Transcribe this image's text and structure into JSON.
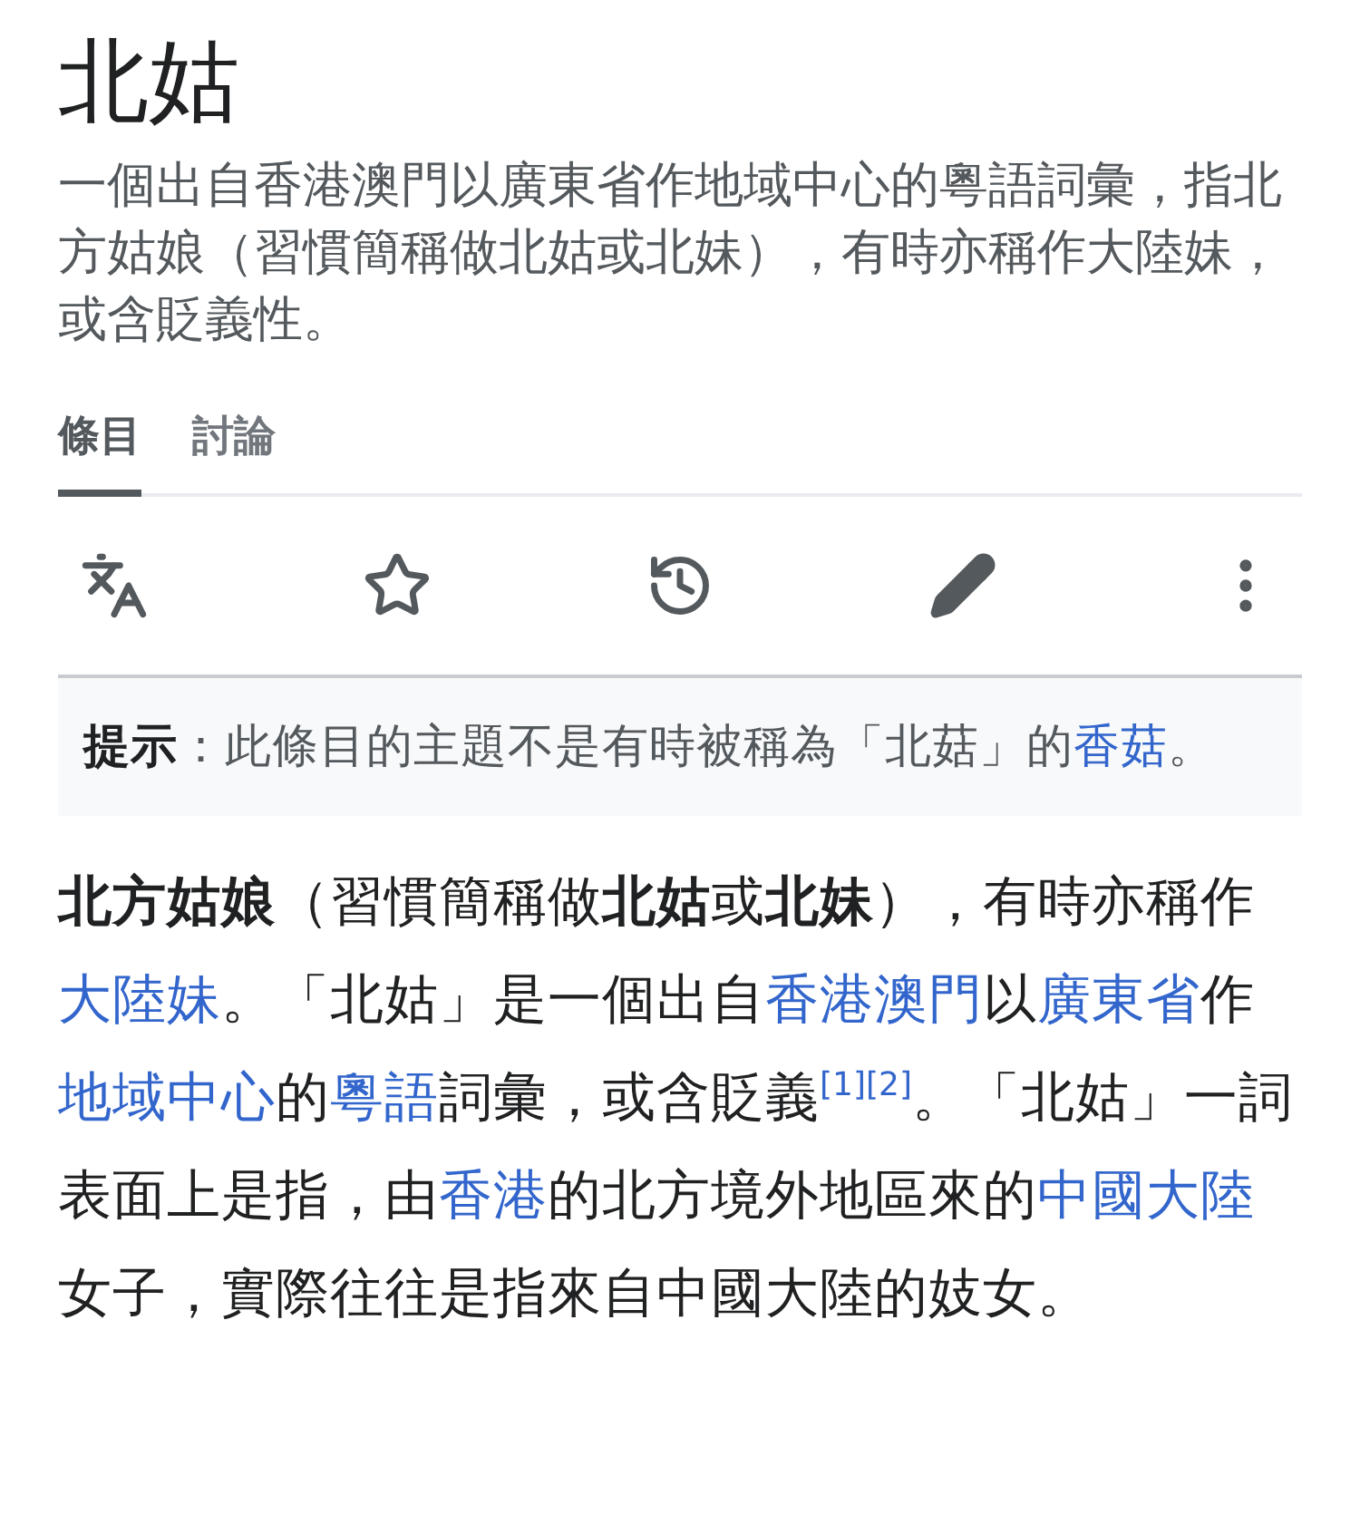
{
  "page": {
    "title": "北姑",
    "description": "一個出自香港澳門以廣東省作地域中心的粵語詞彙，指北方姑娘（習慣簡稱做北姑或北妹），有時亦稱作大陸妹，或含貶義性。"
  },
  "tabs": [
    {
      "label": "條目",
      "selected": true
    },
    {
      "label": "討論",
      "selected": false
    }
  ],
  "actions": [
    {
      "kind": "language"
    },
    {
      "kind": "watch"
    },
    {
      "kind": "history"
    },
    {
      "kind": "edit"
    },
    {
      "kind": "more"
    }
  ],
  "hatnote": [
    {
      "kind": "bold",
      "text": "提示"
    },
    {
      "kind": "text",
      "text": "：此條目的主題不是有時被稱為「北菇」的"
    },
    {
      "kind": "link",
      "text": "香菇"
    },
    {
      "kind": "text",
      "text": "。"
    }
  ],
  "paragraph": [
    {
      "kind": "bold",
      "text": "北方姑娘"
    },
    {
      "kind": "text",
      "text": "（習慣簡稱做"
    },
    {
      "kind": "bold",
      "text": "北姑"
    },
    {
      "kind": "text",
      "text": "或"
    },
    {
      "kind": "bold",
      "text": "北妹"
    },
    {
      "kind": "text",
      "text": "），有時亦稱作"
    },
    {
      "kind": "link",
      "text": "大陸妹"
    },
    {
      "kind": "text",
      "text": "。「北姑」是一個出自"
    },
    {
      "kind": "link",
      "text": "香港澳門"
    },
    {
      "kind": "text",
      "text": "以"
    },
    {
      "kind": "link",
      "text": "廣東省"
    },
    {
      "kind": "text",
      "text": "作"
    },
    {
      "kind": "link",
      "text": "地域中心"
    },
    {
      "kind": "text",
      "text": "的"
    },
    {
      "kind": "link",
      "text": "粵語"
    },
    {
      "kind": "text",
      "text": "詞彙，或含貶義"
    },
    {
      "kind": "ref",
      "text": "[1]"
    },
    {
      "kind": "ref",
      "text": "[2]"
    },
    {
      "kind": "text",
      "text": "。「北姑」一詞表面上是指，由"
    },
    {
      "kind": "link",
      "text": "香港"
    },
    {
      "kind": "text",
      "text": "的北方境外地區來的"
    },
    {
      "kind": "link",
      "text": "中國大陸"
    },
    {
      "kind": "text",
      "text": "女子，實際往往是指來自中國大陸的妓女。"
    }
  ]
}
